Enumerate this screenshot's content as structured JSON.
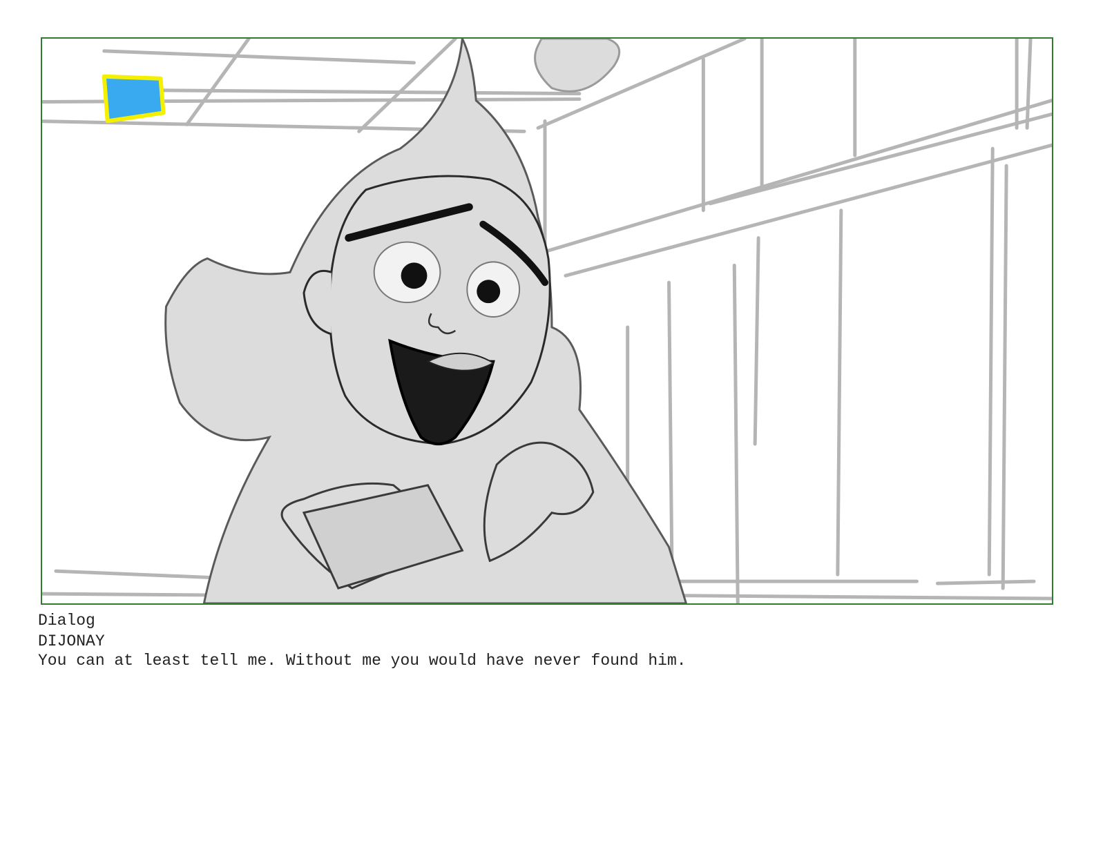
{
  "storyboard": {
    "panel": {
      "icon": "storyboard-sketch-image",
      "marker_color": "#3aaaf0",
      "marker_border_color": "#f4f000",
      "frame_color": "#2e7d2e"
    },
    "dialog": {
      "heading": "Dialog",
      "character": "DIJONAY",
      "line": "You can at least tell me. Without me you would have never found him."
    }
  }
}
